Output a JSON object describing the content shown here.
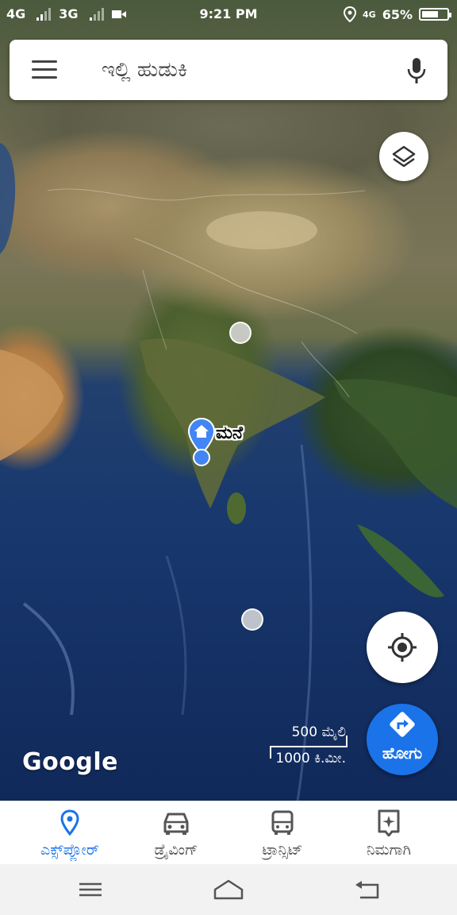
{
  "status_bar": {
    "network_1": "4G",
    "network_2": "3G",
    "time": "9:21 PM",
    "mobile_data": "4G",
    "battery": "65%",
    "battery_level": 0.65
  },
  "search": {
    "placeholder": "ಇಲ್ಲಿ ಹುಡುಕಿ"
  },
  "map": {
    "home_label": "ಮನೆ",
    "attribution": "Google",
    "scale_miles": "500 ಮೈಲಿ",
    "scale_km": "1000 ಕಿ.ಮೀ."
  },
  "go_button": {
    "label": "ಹೋಗು"
  },
  "bottom_nav": {
    "items": [
      {
        "label": "ಎಕ್ಸ್‌ಪ್ಲೋರ್",
        "icon": "place-pin-icon",
        "active": true
      },
      {
        "label": "ಡ್ರೈವಿಂಗ್",
        "icon": "car-icon",
        "active": false
      },
      {
        "label": "ಟ್ರಾನ್ಸಿಟ್",
        "icon": "bus-icon",
        "active": false
      },
      {
        "label": "ನಿಮಗಾಗಿ",
        "icon": "sparkle-bookmark-icon",
        "active": false
      }
    ]
  },
  "colors": {
    "accent": "#1a73e8",
    "location_dot": "#4285f4"
  }
}
